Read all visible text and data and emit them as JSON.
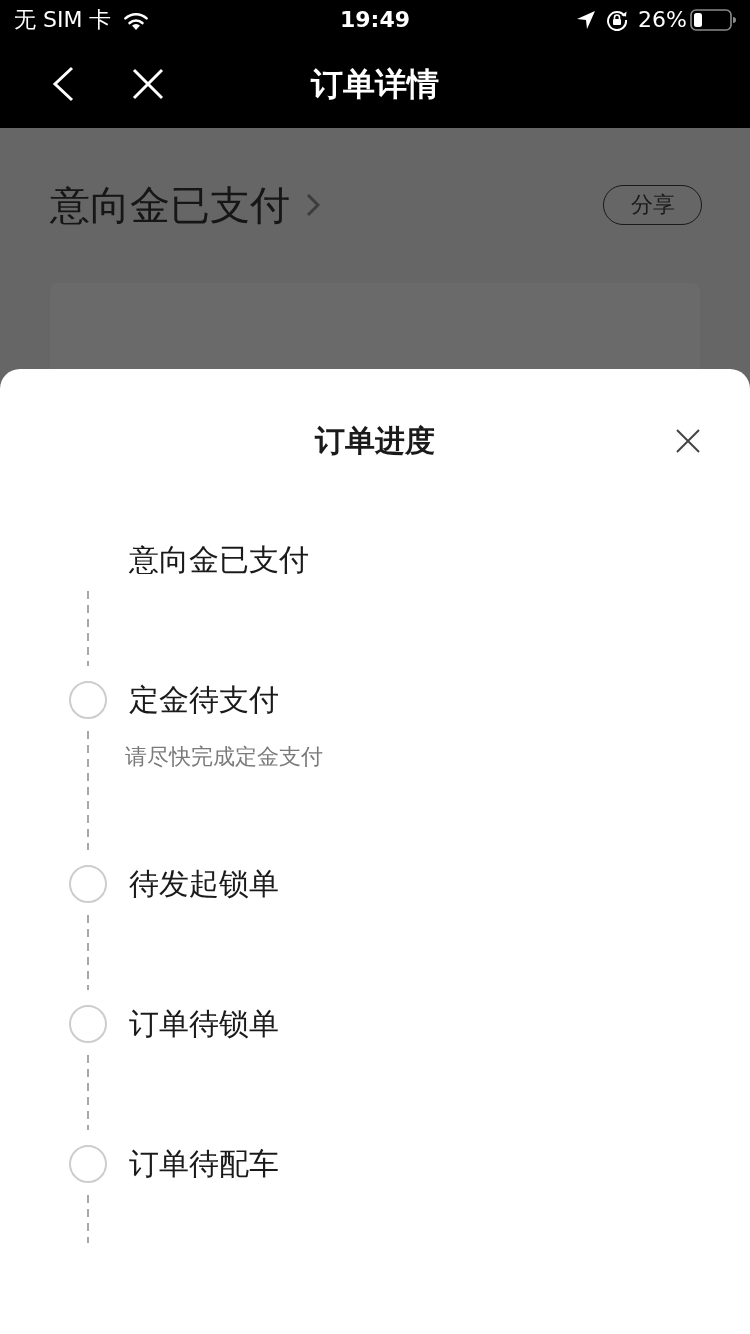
{
  "status_bar": {
    "carrier": "无 SIM 卡",
    "time": "19:49",
    "battery": "26%"
  },
  "nav_bar": {
    "title": "订单详情"
  },
  "page": {
    "status_title": "意向金已支付",
    "share_button": "分享"
  },
  "sheet": {
    "title": "订单进度",
    "steps": [
      {
        "title": "意向金已支付",
        "done": true
      },
      {
        "title": "定金待支付",
        "subtitle": "请尽快完成定金支付",
        "done": false
      },
      {
        "title": "待发起锁单",
        "done": false
      },
      {
        "title": "订单待锁单",
        "done": false
      },
      {
        "title": "订单待配车",
        "done": false
      }
    ]
  }
}
